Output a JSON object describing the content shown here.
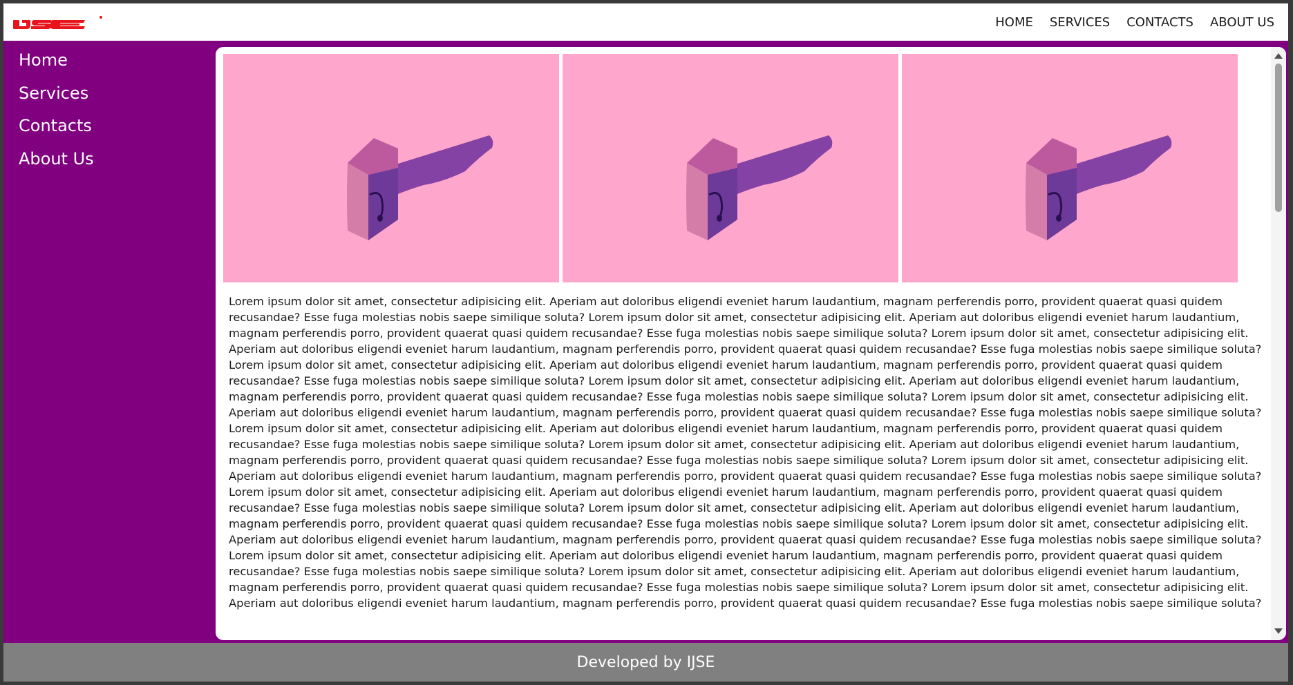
{
  "header": {
    "logo_text": "IJSE",
    "brand_color": "#e8141c",
    "nav": [
      {
        "label": "HOME",
        "icon": ""
      },
      {
        "label": "SERVICES",
        "icon": ""
      },
      {
        "label": "CONTACTS",
        "icon": ""
      },
      {
        "label": "ABOUT US",
        "icon": ""
      }
    ]
  },
  "sidebar": {
    "background": "#800080",
    "items": [
      {
        "label": "Home"
      },
      {
        "label": "Services"
      },
      {
        "label": "Contacts"
      },
      {
        "label": "About Us"
      }
    ]
  },
  "main": {
    "gallery": [
      {
        "icon": "pink-box-illustration"
      },
      {
        "icon": "pink-box-illustration"
      },
      {
        "icon": "pink-box-illustration"
      }
    ],
    "paragraph": "Lorem ipsum dolor sit amet, consectetur adipisicing elit. Aperiam aut doloribus eligendi eveniet harum laudantium, magnam perferendis porro, provident quaerat quasi quidem recusandae? Esse fuga molestias nobis saepe similique soluta? Lorem ipsum dolor sit amet, consectetur adipisicing elit. Aperiam aut doloribus eligendi eveniet harum laudantium, magnam perferendis porro, provident quaerat quasi quidem recusandae? Esse fuga molestias nobis saepe similique soluta? Lorem ipsum dolor sit amet, consectetur adipisicing elit. Aperiam aut doloribus eligendi eveniet harum laudantium, magnam perferendis porro, provident quaerat quasi quidem recusandae? Esse fuga molestias nobis saepe similique soluta? Lorem ipsum dolor sit amet, consectetur adipisicing elit. Aperiam aut doloribus eligendi eveniet harum laudantium, magnam perferendis porro, provident quaerat quasi quidem recusandae? Esse fuga molestias nobis saepe similique soluta? Lorem ipsum dolor sit amet, consectetur adipisicing elit. Aperiam aut doloribus eligendi eveniet harum laudantium, magnam perferendis porro, provident quaerat quasi quidem recusandae? Esse fuga molestias nobis saepe similique soluta? Lorem ipsum dolor sit amet, consectetur adipisicing elit. Aperiam aut doloribus eligendi eveniet harum laudantium, magnam perferendis porro, provident quaerat quasi quidem recusandae? Esse fuga molestias nobis saepe similique soluta? Lorem ipsum dolor sit amet, consectetur adipisicing elit. Aperiam aut doloribus eligendi eveniet harum laudantium, magnam perferendis porro, provident quaerat quasi quidem recusandae? Esse fuga molestias nobis saepe similique soluta? Lorem ipsum dolor sit amet, consectetur adipisicing elit. Aperiam aut doloribus eligendi eveniet harum laudantium, magnam perferendis porro, provident quaerat quasi quidem recusandae? Esse fuga molestias nobis saepe similique soluta? Lorem ipsum dolor sit amet, consectetur adipisicing elit. Aperiam aut doloribus eligendi eveniet harum laudantium, magnam perferendis porro, provident quaerat quasi quidem recusandae? Esse fuga molestias nobis saepe similique soluta? Lorem ipsum dolor sit amet, consectetur adipisicing elit. Aperiam aut doloribus eligendi eveniet harum laudantium, magnam perferendis porro, provident quaerat quasi quidem recusandae? Esse fuga molestias nobis saepe similique soluta? Lorem ipsum dolor sit amet, consectetur adipisicing elit. Aperiam aut doloribus eligendi eveniet harum laudantium, magnam perferendis porro, provident quaerat quasi quidem recusandae? Esse fuga molestias nobis saepe similique soluta? Lorem ipsum dolor sit amet, consectetur adipisicing elit. Aperiam aut doloribus eligendi eveniet harum laudantium, magnam perferendis porro, provident quaerat quasi quidem recusandae? Esse fuga molestias nobis saepe similique soluta? Lorem ipsum dolor sit amet, consectetur adipisicing elit. Aperiam aut doloribus eligendi eveniet harum laudantium, magnam perferendis porro, provident quaerat quasi quidem recusandae? Esse fuga molestias nobis saepe similique soluta? Lorem ipsum dolor sit amet, consectetur adipisicing elit. Aperiam aut doloribus eligendi eveniet harum laudantium, magnam perferendis porro, provident quaerat quasi quidem recusandae? Esse fuga molestias nobis saepe similique soluta? Lorem ipsum dolor sit amet, consectetur adipisicing elit. Aperiam aut doloribus eligendi eveniet harum laudantium, magnam perferendis porro, provident quaerat quasi quidem recusandae? Esse fuga molestias nobis saepe similique soluta?"
  },
  "footer": {
    "text": "Developed by IJSE",
    "background": "#808080"
  }
}
